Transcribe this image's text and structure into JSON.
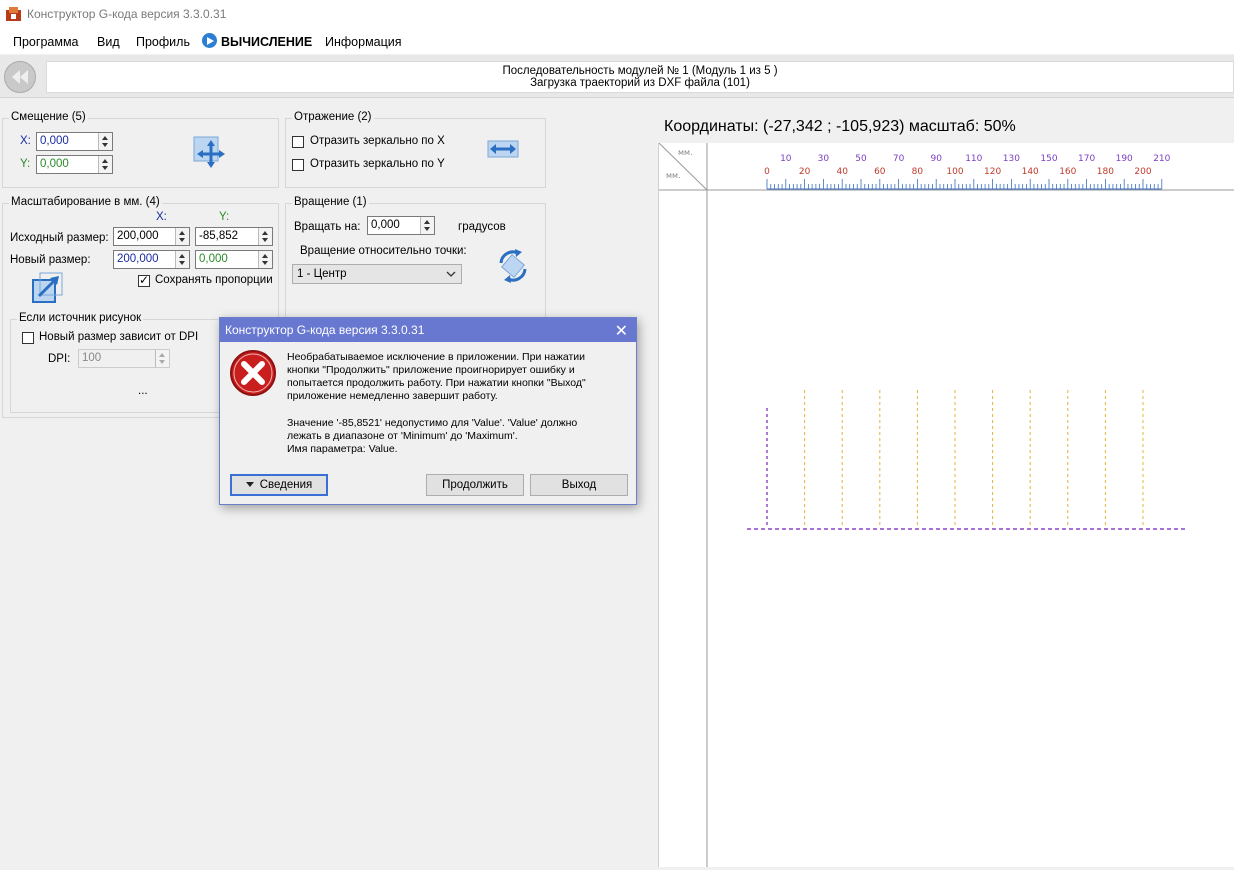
{
  "window": {
    "title": "Конструктор G-кода версия 3.3.0.31"
  },
  "menu": {
    "items": [
      "Программа",
      "Вид",
      "Профиль"
    ],
    "calc_label": "ВЫЧИСЛЕНИЕ",
    "info_label": "Информация"
  },
  "sequence": {
    "line1": "Последовательность модулей № 1 (Модуль 1 из 5 )",
    "line2": "Загрузка траекторий из DXF файла (101)"
  },
  "offset": {
    "title": "Смещение (5)",
    "x_label": "X:",
    "x_value": "0,000",
    "y_label": "Y:",
    "y_value": "0,000"
  },
  "mirror": {
    "title": "Отражение (2)",
    "mirror_x": "Отразить зеркально по X",
    "mirror_y": "Отразить зеркально по Y"
  },
  "scale": {
    "title": "Масштабирование в мм. (4)",
    "col_x": "X:",
    "col_y": "Y:",
    "source_label": "Исходный размер:",
    "source_x": "200,000",
    "source_y": "-85,852",
    "new_label": "Новый размер:",
    "new_x": "200,000",
    "new_y": "0,000",
    "keep_ratio": "Сохранять пропорции"
  },
  "picture": {
    "title": "Если источник рисунок",
    "dpi_checkbox": "Новый размер зависит от DPI",
    "dpi_label": "DPI:",
    "dpi_value": "100",
    "ellipsis": "..."
  },
  "rotation": {
    "title": "Вращение (1)",
    "rotate_label": "Вращать на:",
    "rotate_value": "0,000",
    "degrees": "градусов",
    "point_label": "Вращение относительно точки:",
    "point_value": "1 - Центр"
  },
  "view": {
    "coords": "Координаты: (-27,342 ; -105,923) масштаб: 50%",
    "ruler_unit_top": "мм.",
    "ruler_unit_left": "мм.",
    "ruler_labels_even": [
      "0",
      "20",
      "40",
      "60",
      "80",
      "100",
      "120",
      "140",
      "160",
      "180",
      "200"
    ],
    "ruler_labels_odd": [
      "10",
      "30",
      "50",
      "70",
      "90",
      "110",
      "130",
      "150",
      "170",
      "190",
      "210"
    ]
  },
  "dialog": {
    "title": "Конструктор G-кода версия 3.3.0.31",
    "close": "✕",
    "message_lines": [
      "Необрабатываемое исключение в приложении. При нажатии",
      "кнопки \"Продолжить\" приложение проигнорирует ошибку и",
      "попытается продолжить работу. При нажатии кнопки \"Выход\"",
      "приложение немедленно завершит работу."
    ],
    "detail_lines": [
      "Значение '-85,8521' недопустимо для 'Value'. 'Value' должно",
      "лежать в диапазоне от 'Minimum' до 'Maximum'.",
      "Имя параметра: Value."
    ],
    "details_button": "Сведения",
    "continue_button": "Продолжить",
    "exit_button": "Выход"
  },
  "colors": {
    "ruler_even": "#c0392b",
    "ruler_odd": "#7b3fc4",
    "path_purple": "#7a1fb8",
    "path_yellow": "#e0b43c"
  }
}
